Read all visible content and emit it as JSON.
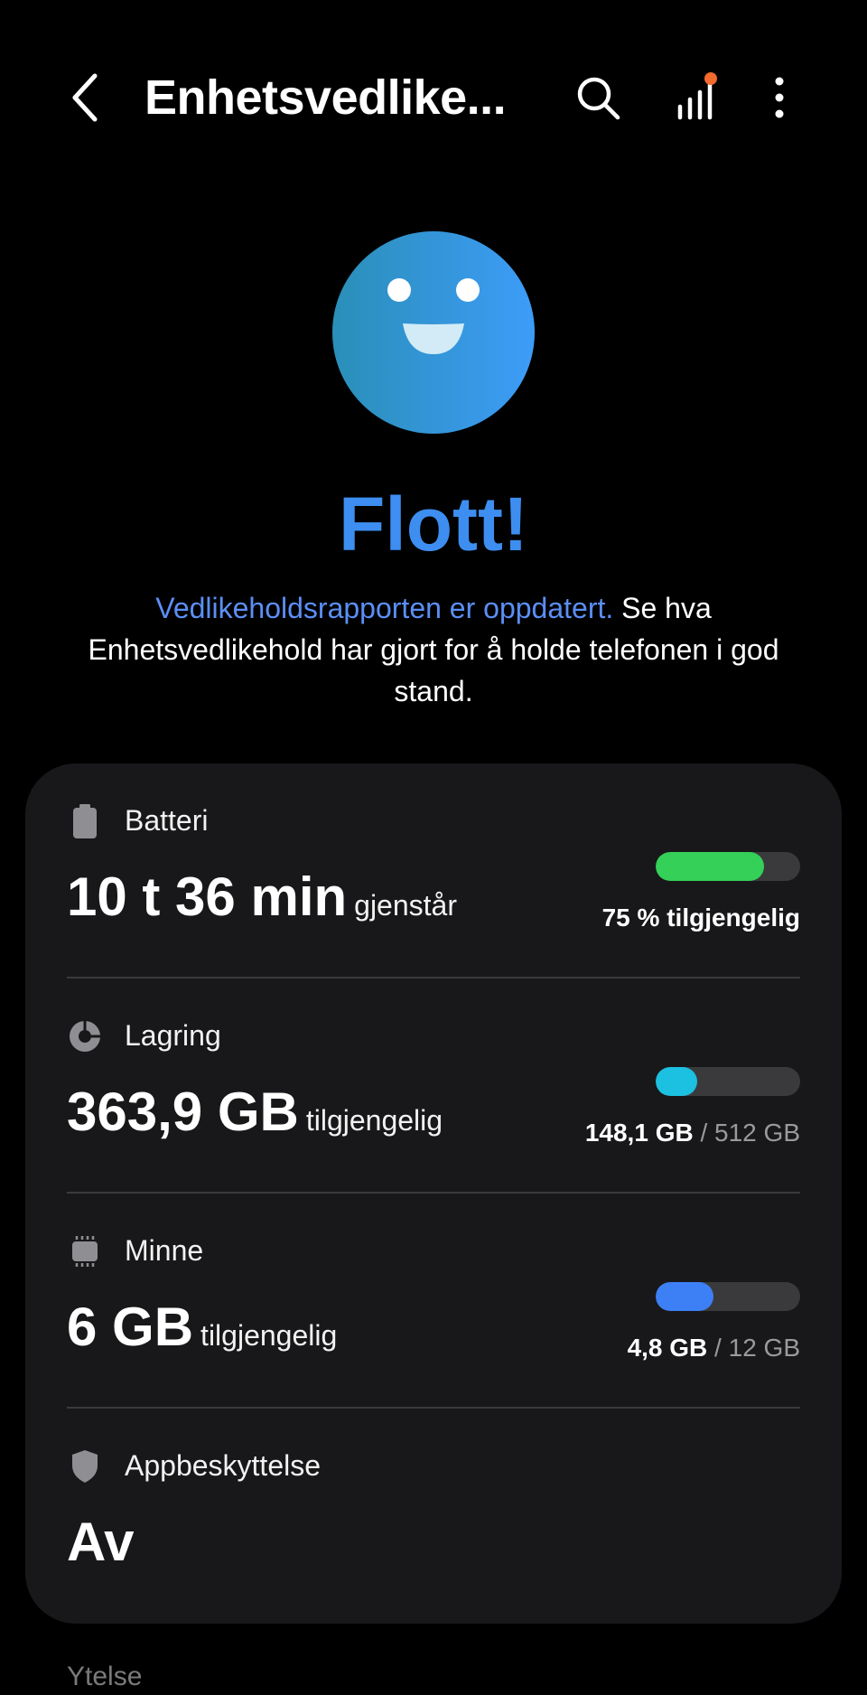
{
  "header": {
    "title": "Enhetsvedlike...",
    "icons": {
      "back": "back-arrow-icon",
      "search": "search-icon",
      "stats": "stats-bars-icon",
      "more": "more-vertical-icon"
    },
    "notification_dot_color": "#f26a2e"
  },
  "hero": {
    "icon": "smiley-face-icon",
    "headline": "Flott!",
    "description_link": "Vedlikeholdsrapporten er oppdatert.",
    "description_rest": " Se hva Enhetsvedlikehold har gjort for å holde telefonen i god stand."
  },
  "card": {
    "battery": {
      "label": "Batteri",
      "icon": "battery-icon",
      "value": "10 t 36 min",
      "value_suffix": "gjenstår",
      "bar_level": 0.75,
      "bar_color": "#34d058",
      "right_strong": "75 % tilgjengelig",
      "right_muted": ""
    },
    "storage": {
      "label": "Lagring",
      "icon": "pie-chart-icon",
      "value": "363,9 GB",
      "value_suffix": "tilgjengelig",
      "bar_level": 0.29,
      "bar_color": "#1cc0e0",
      "right_strong": "148,1 GB",
      "right_muted": " / 512 GB"
    },
    "memory": {
      "label": "Minne",
      "icon": "memory-chip-icon",
      "value": "6 GB",
      "value_suffix": "tilgjengelig",
      "bar_level": 0.4,
      "bar_color": "#3d7ff5",
      "right_strong": "4,8 GB",
      "right_muted": " / 12 GB"
    },
    "app_protection": {
      "label": "Appbeskyttelse",
      "icon": "shield-icon",
      "value": "Av"
    }
  },
  "next_section": {
    "label": "Ytelse"
  }
}
